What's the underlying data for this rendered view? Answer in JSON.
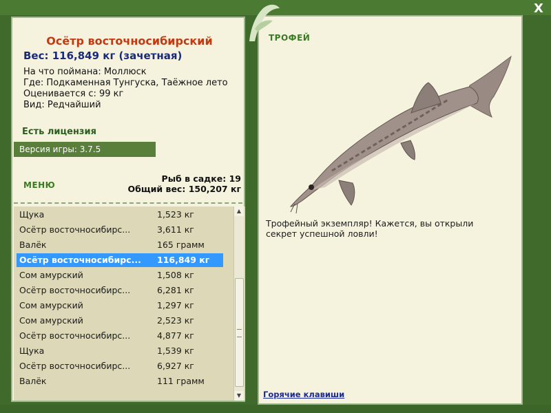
{
  "fish": {
    "name": "Осётр восточносибирский",
    "weight": "Вес: 116,849 кг (зачетная)",
    "caught_with": "На что поймана: Моллюск",
    "location": "Где: Подкаменная Тунгуска, Таёжное лето",
    "valued_from": "Оценивается с: 99 кг",
    "rarity": "Вид: Редчайший"
  },
  "license": "Есть лицензия",
  "version": "Версия игры: 3.7.5",
  "menu_label": "МЕНЮ",
  "stats": {
    "fish_count": "Рыб в садке: 19",
    "total_weight": "Общий вес: 150,207 кг"
  },
  "list": [
    {
      "name": "Щука",
      "weight": "1,523 кг"
    },
    {
      "name": "Осётр восточносибирс...",
      "weight": "3,611 кг"
    },
    {
      "name": "Валёк",
      "weight": "165 грамм"
    },
    {
      "name": "Осётр восточносибирс...",
      "weight": "116,849 кг",
      "selected": true
    },
    {
      "name": "Сом амурский",
      "weight": "1,508 кг"
    },
    {
      "name": "Осётр восточносибирс...",
      "weight": "6,281 кг"
    },
    {
      "name": "Сом амурский",
      "weight": "1,297 кг"
    },
    {
      "name": "Сом амурский",
      "weight": "2,523 кг"
    },
    {
      "name": "Осётр восточносибирс...",
      "weight": "4,877 кг"
    },
    {
      "name": "Щука",
      "weight": "1,539 кг"
    },
    {
      "name": "Осётр восточносибирс...",
      "weight": "6,927 кг"
    },
    {
      "name": "Валёк",
      "weight": "111 грамм"
    }
  ],
  "trophy_label": "ТРОФЕЙ",
  "trophy_text": "Трофейный экземпляр! Кажется, вы открыли секрет успешной ловли!",
  "hotkeys_label": "Горячие клавиши",
  "close_label": "X",
  "colors": {
    "frame": "#3f6a2c",
    "panel": "#f5f2de",
    "title": "#c23a12",
    "weight": "#1a2a7a",
    "selection": "#3399ff",
    "version_bar": "#5a7f3a"
  }
}
